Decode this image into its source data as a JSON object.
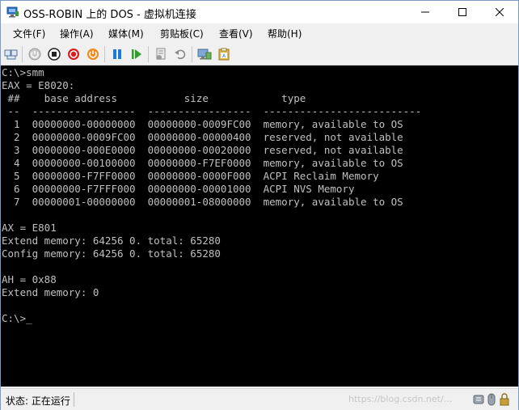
{
  "window": {
    "title": "OSS-ROBIN 上的 DOS - 虚拟机连接"
  },
  "menu": {
    "items": [
      {
        "label": "文件(F)"
      },
      {
        "label": "操作(A)"
      },
      {
        "label": "媒体(M)"
      },
      {
        "label": "剪贴板(C)"
      },
      {
        "label": "查看(V)"
      },
      {
        "label": "帮助(H)"
      }
    ]
  },
  "toolbar": {
    "buttons": [
      {
        "icon": "ctrl-alt-del-icon"
      },
      {
        "icon": "start-icon"
      },
      {
        "icon": "turn-off-icon"
      },
      {
        "icon": "shutdown-icon"
      },
      {
        "icon": "power-icon"
      },
      {
        "icon": "pause-icon"
      },
      {
        "icon": "resume-icon"
      },
      {
        "icon": "checkpoint-icon"
      },
      {
        "icon": "revert-icon"
      },
      {
        "icon": "enhanced-session-icon"
      },
      {
        "icon": "type-clipboard-icon"
      }
    ]
  },
  "console": {
    "lines": [
      "C:\\>smm",
      "EAX = E8020:",
      " ##    base address           size            type",
      " --  -----------------  -----------------  --------------------------",
      "  1  00000000-00000000  00000000-0009FC00  memory, available to OS",
      "  2  00000000-0009FC00  00000000-00000400  reserved, not available",
      "  3  00000000-000E0000  00000000-00020000  reserved, not available",
      "  4  00000000-00100000  00000000-F7EF0000  memory, available to OS",
      "  5  00000000-F7FF0000  00000000-0000F000  ACPI Reclaim Memory",
      "  6  00000000-F7FFF000  00000000-00001000  ACPI NVS Memory",
      "  7  00000001-00000000  00000001-08000000  memory, available to OS",
      "",
      "AX = E801",
      "Extend memory: 64256 0. total: 65280",
      "Config memory: 64256 0. total: 65280",
      "",
      "AH = 0x88",
      "Extend memory: 0",
      "",
      "C:\\>"
    ],
    "cursor": "_"
  },
  "status": {
    "text": "状态: 正在运行",
    "watermark": "https://blog.csdn.net/..."
  }
}
